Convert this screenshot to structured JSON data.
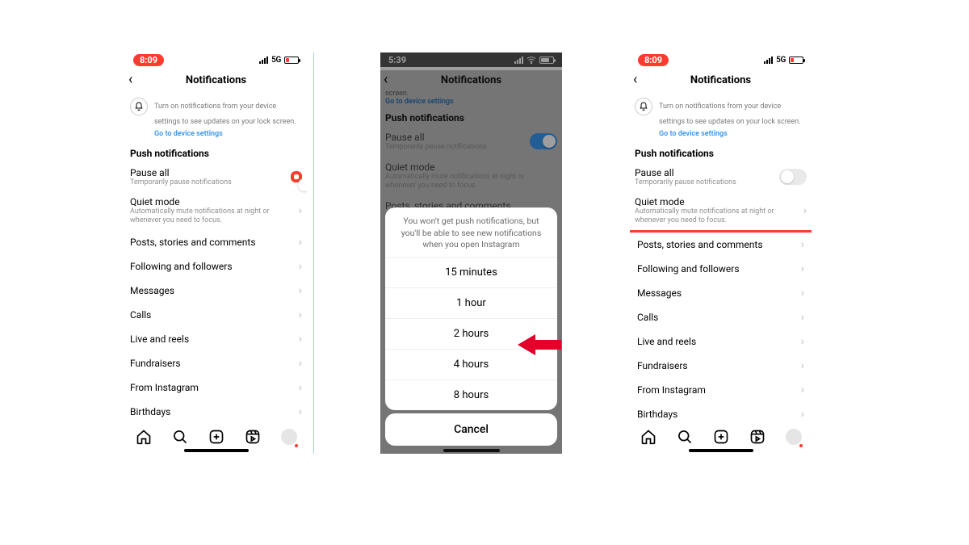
{
  "left": {
    "status": {
      "time": "8:09",
      "net": "5G"
    },
    "title": "Notifications",
    "notice": {
      "text": "Turn on notifications from your device settings to see updates on your lock screen.",
      "link": "Go to device settings"
    },
    "section": "Push notifications",
    "pause": {
      "title": "Pause all",
      "sub": "Temporarily pause notifications"
    },
    "quiet": {
      "title": "Quiet mode",
      "sub": "Automatically mute notifications at night or whenever you need to focus."
    },
    "rows": [
      "Posts, stories and comments",
      "Following and followers",
      "Messages",
      "Calls",
      "Live and reels",
      "Fundraisers",
      "From Instagram",
      "Birthdays"
    ]
  },
  "mid": {
    "status": {
      "time": "5:39"
    },
    "title": "Notifications",
    "notice_link": "Go to device settings",
    "notice_tail": "screen.",
    "section": "Push notifications",
    "pause": {
      "title": "Pause all",
      "sub": "Temporarily pause notifications"
    },
    "quiet": {
      "title": "Quiet mode",
      "sub": "Automatically mute notifications at night or whenever you need to focus."
    },
    "row0": "Posts, stories and comments",
    "sheet": {
      "msg": "You won't get push notifications, but you'll be able to see new notifications when you open Instagram",
      "opts": [
        "15 minutes",
        "1 hour",
        "2 hours",
        "4 hours",
        "8 hours"
      ],
      "cancel": "Cancel"
    }
  },
  "right": {
    "status": {
      "time": "8:09",
      "net": "5G"
    },
    "title": "Notifications",
    "notice": {
      "text": "Turn on notifications from your device settings to see updates on your lock screen.",
      "link": "Go to device settings"
    },
    "section": "Push notifications",
    "pause": {
      "title": "Pause all",
      "sub": "Temporarily pause notifications"
    },
    "quiet": {
      "title": "Quiet mode",
      "sub": "Automatically mute notifications at night or whenever you need to focus."
    },
    "rows": [
      "Posts, stories and comments",
      "Following and followers",
      "Messages",
      "Calls",
      "Live and reels",
      "Fundraisers",
      "From Instagram",
      "Birthdays"
    ]
  }
}
